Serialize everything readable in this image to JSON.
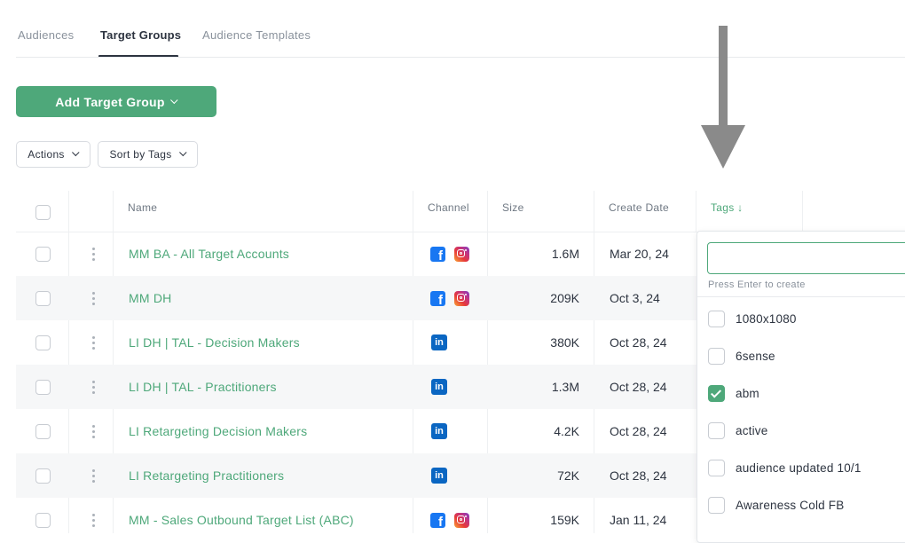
{
  "tabs": [
    {
      "label": "Audiences"
    },
    {
      "label": "Target Groups"
    },
    {
      "label": "Audience Templates"
    }
  ],
  "active_tab": "Target Groups",
  "toolbar": {
    "add_button": "Add Target Group",
    "actions": "Actions",
    "sort": "Sort by Tags"
  },
  "table": {
    "headers": {
      "name": "Name",
      "channel": "Channel",
      "size": "Size",
      "create_date": "Create Date",
      "tags": "Tags ↓"
    },
    "rows": [
      {
        "name": "MM BA - All Target Accounts",
        "channels": [
          "facebook-icon",
          "instagram-icon"
        ],
        "size": "1.6M",
        "date": "Mar 20, 24"
      },
      {
        "name": "MM DH",
        "channels": [
          "facebook-icon",
          "instagram-icon"
        ],
        "size": "209K",
        "date": "Oct 3, 24"
      },
      {
        "name": "LI DH | TAL - Decision Makers",
        "channels": [
          "linkedin-icon"
        ],
        "size": "380K",
        "date": "Oct 28, 24"
      },
      {
        "name": "LI DH | TAL - Practitioners",
        "channels": [
          "linkedin-icon"
        ],
        "size": "1.3M",
        "date": "Oct 28, 24"
      },
      {
        "name": "LI Retargeting Decision Makers",
        "channels": [
          "linkedin-icon"
        ],
        "size": "4.2K",
        "date": "Oct 28, 24"
      },
      {
        "name": "LI Retargeting Practitioners",
        "channels": [
          "linkedin-icon"
        ],
        "size": "72K",
        "date": "Oct 28, 24"
      },
      {
        "name": "MM - Sales Outbound Target List (ABC)",
        "channels": [
          "facebook-icon",
          "instagram-icon"
        ],
        "size": "159K",
        "date": "Jan 11, 24"
      }
    ]
  },
  "tags_dropdown": {
    "input_value": "",
    "hint": "Press Enter to create",
    "options": [
      {
        "label": "1080x1080",
        "checked": false
      },
      {
        "label": "6sense",
        "checked": false
      },
      {
        "label": "abm",
        "checked": true
      },
      {
        "label": "active",
        "checked": false
      },
      {
        "label": "audience updated 10/1",
        "checked": false
      },
      {
        "label": "Awareness Cold FB",
        "checked": false
      }
    ]
  },
  "colors": {
    "accent": "#4ea87a",
    "facebook": "#1877f2",
    "linkedin": "#0a66c2",
    "annotation_arrow": "#8a8a8a"
  }
}
